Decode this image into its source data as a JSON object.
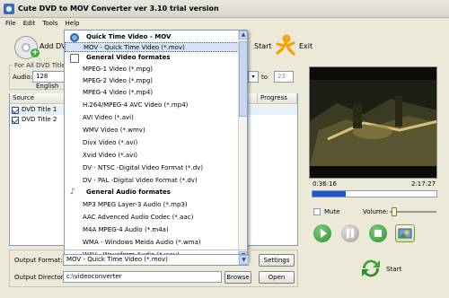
{
  "window": {
    "title": "Cute DVD to MOV Converter ver 3.10  trial version"
  },
  "menu": [
    "File",
    "Edit",
    "Tools",
    "Help"
  ],
  "toolbar": {
    "add_label": "Add DVD",
    "start_label": "Start",
    "exit_label": "Exit"
  },
  "left": {
    "group_title": "For All DVD Titles",
    "audio_label": "Audio:",
    "audio_value": "128  English",
    "to_label": "to",
    "to_value": "23"
  },
  "table": {
    "headers": [
      "Source",
      "Progress"
    ],
    "rows": [
      {
        "label": "DVD Title 1",
        "checked": true
      },
      {
        "label": "DVD Title 2",
        "checked": true
      }
    ]
  },
  "dropdown": {
    "items": [
      {
        "label": "Quick Time Video - MOV",
        "type": "header"
      },
      {
        "label": "MOV - Quick Time Video (*.mov)",
        "type": "item",
        "selected": true
      },
      {
        "label": "General Video formates",
        "type": "header"
      },
      {
        "label": "MPEG-1 Video (*.mpg)",
        "type": "item"
      },
      {
        "label": "MPEG-2 Video (*.mpg)",
        "type": "item"
      },
      {
        "label": "MPEG-4 Video (*.mp4)",
        "type": "item"
      },
      {
        "label": "H.264/MPEG-4 AVC Video (*.mp4)",
        "type": "item"
      },
      {
        "label": "AVI Video (*.avi)",
        "type": "item"
      },
      {
        "label": "WMV Video (*.wmv)",
        "type": "item"
      },
      {
        "label": "Divx Video (*.avi)",
        "type": "item"
      },
      {
        "label": "Xvid Video (*.avi)",
        "type": "item"
      },
      {
        "label": "DV - NTSC -Digital Video Format (*.dv)",
        "type": "item"
      },
      {
        "label": "DV - PAL -Digital Video Format (*.dv)",
        "type": "item"
      },
      {
        "label": "General Audio formates",
        "type": "header"
      },
      {
        "label": "MP3 MPEG Layer-3 Audio (*.mp3)",
        "type": "item"
      },
      {
        "label": "AAC Advenced Audio Codec (*.aac)",
        "type": "item"
      },
      {
        "label": "M4A MPEG-4 Audio (*.m4a)",
        "type": "item"
      },
      {
        "label": "WMA - Windows Meida Audio (*.wma)",
        "type": "item"
      },
      {
        "label": "WAV - Waveform Audio (*.wav)",
        "type": "item"
      }
    ]
  },
  "output": {
    "format_label": "Output Format:",
    "format_value": "MOV - Quick Time Video (*.mov)",
    "dir_label": "Output Directory:",
    "dir_value": "c:\\videoconverter",
    "settings_label": "Settings",
    "browse_label": "Browse",
    "open_label": "Open"
  },
  "player": {
    "time_current": "0:36:16",
    "time_total": "2:17:27",
    "progress_fraction": 0.27,
    "mute_label": "Mute",
    "volume_label": "Volume:",
    "volume_fraction": 0.05
  },
  "bottom": {
    "start_label": "Start"
  },
  "colors": {
    "accent": "#2055c4",
    "window_bg": "#ece9d8",
    "green": "#3aa63a"
  }
}
